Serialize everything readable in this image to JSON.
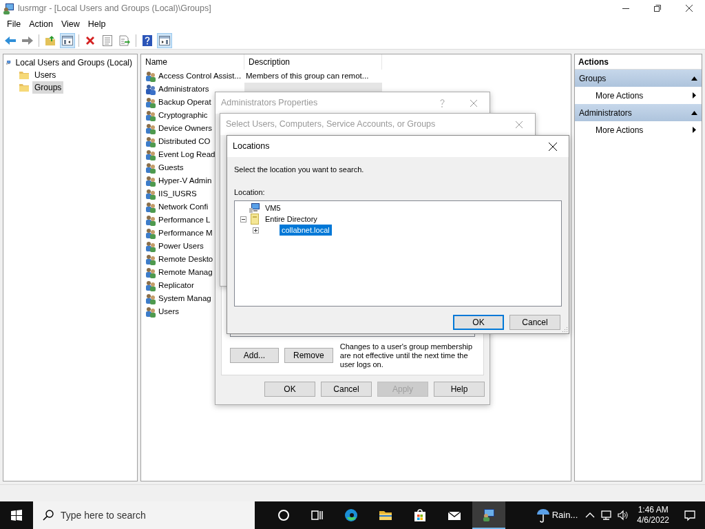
{
  "window": {
    "title": "lusrmgr - [Local Users and Groups (Local)\\Groups]"
  },
  "menu": [
    "File",
    "Action",
    "View",
    "Help"
  ],
  "toolbar": [
    {
      "kind": "back"
    },
    {
      "kind": "forward"
    },
    {
      "kind": "sep"
    },
    {
      "kind": "up"
    },
    {
      "kind": "tree",
      "pressed": true
    },
    {
      "kind": "sep"
    },
    {
      "kind": "delete"
    },
    {
      "kind": "properties"
    },
    {
      "kind": "export"
    },
    {
      "kind": "sep"
    },
    {
      "kind": "help"
    },
    {
      "kind": "actionpane",
      "pressed": true
    }
  ],
  "tree": [
    {
      "label": "Local Users and Groups (Local)",
      "kind": "computer",
      "selected": false,
      "children": [
        {
          "label": "Users",
          "kind": "folder",
          "selected": false
        },
        {
          "label": "Groups",
          "kind": "folder",
          "selected": true
        }
      ]
    }
  ],
  "list": {
    "columns": [
      "Name",
      "Description"
    ],
    "rows": [
      {
        "name": "Access Control Assist...",
        "description": "Members of this group can remot...",
        "selected": false
      },
      {
        "name": "Administrators",
        "selected": true
      },
      {
        "name": "Backup Operat",
        "selected": false
      },
      {
        "name": "Cryptographic",
        "selected": false
      },
      {
        "name": "Device Owners",
        "selected": false
      },
      {
        "name": "Distributed CO",
        "selected": false
      },
      {
        "name": "Event Log Read",
        "selected": false
      },
      {
        "name": "Guests",
        "selected": false
      },
      {
        "name": "Hyper-V Admin",
        "selected": false
      },
      {
        "name": "IIS_IUSRS",
        "selected": false
      },
      {
        "name": "Network Confi",
        "selected": false
      },
      {
        "name": "Performance L",
        "selected": false
      },
      {
        "name": "Performance M",
        "selected": false
      },
      {
        "name": "Power Users",
        "selected": false
      },
      {
        "name": "Remote Deskto",
        "selected": false
      },
      {
        "name": "Remote Manag",
        "selected": false
      },
      {
        "name": "Replicator",
        "selected": false
      },
      {
        "name": "System Manag",
        "selected": false
      },
      {
        "name": "Users",
        "selected": false
      }
    ]
  },
  "actions": {
    "title": "Actions",
    "sections": [
      {
        "title": "Groups",
        "items": [
          "More Actions"
        ]
      },
      {
        "title": "Administrators",
        "items": [
          "More Actions"
        ]
      }
    ]
  },
  "properties_dialog": {
    "title": "Administrators Properties",
    "buttons": [
      {
        "label": "Add...",
        "disabled": false
      },
      {
        "label": "Remove",
        "disabled": false
      }
    ],
    "note": "Changes to a user's group membership are not effective until the next time the user logs on.",
    "footer_buttons": [
      {
        "label": "OK",
        "disabled": false
      },
      {
        "label": "Cancel",
        "disabled": false
      },
      {
        "label": "Apply",
        "disabled": true
      },
      {
        "label": "Help",
        "disabled": false
      }
    ]
  },
  "select_dialog": {
    "title": "Select Users, Computers, Service Accounts, or Groups"
  },
  "locations_dialog": {
    "title": "Locations",
    "prompt": "Select the location you want to search.",
    "label": "Location:",
    "tree": [
      {
        "label": "VM5",
        "kind": "computer",
        "selected": false
      },
      {
        "label": "Entire Directory",
        "kind": "directory",
        "expanded": true,
        "selected": false,
        "children": [
          {
            "label": "collabnet.local",
            "expanded": false,
            "selected": true
          }
        ]
      }
    ],
    "buttons": [
      {
        "label": "OK",
        "default": true
      },
      {
        "label": "Cancel",
        "default": false
      }
    ]
  },
  "taskbar": {
    "search": {
      "placeholder": "Type here to search"
    },
    "apps": [
      {
        "kind": "cortana",
        "active": false
      },
      {
        "kind": "taskview",
        "active": false
      },
      {
        "kind": "edge",
        "active": false
      },
      {
        "kind": "explorer",
        "active": false
      },
      {
        "kind": "store",
        "active": false
      },
      {
        "kind": "mail",
        "active": false
      },
      {
        "kind": "lusrmgr",
        "active": true
      }
    ],
    "weather": "Rain...",
    "time": "1:46 AM",
    "date": "4/6/2022"
  }
}
